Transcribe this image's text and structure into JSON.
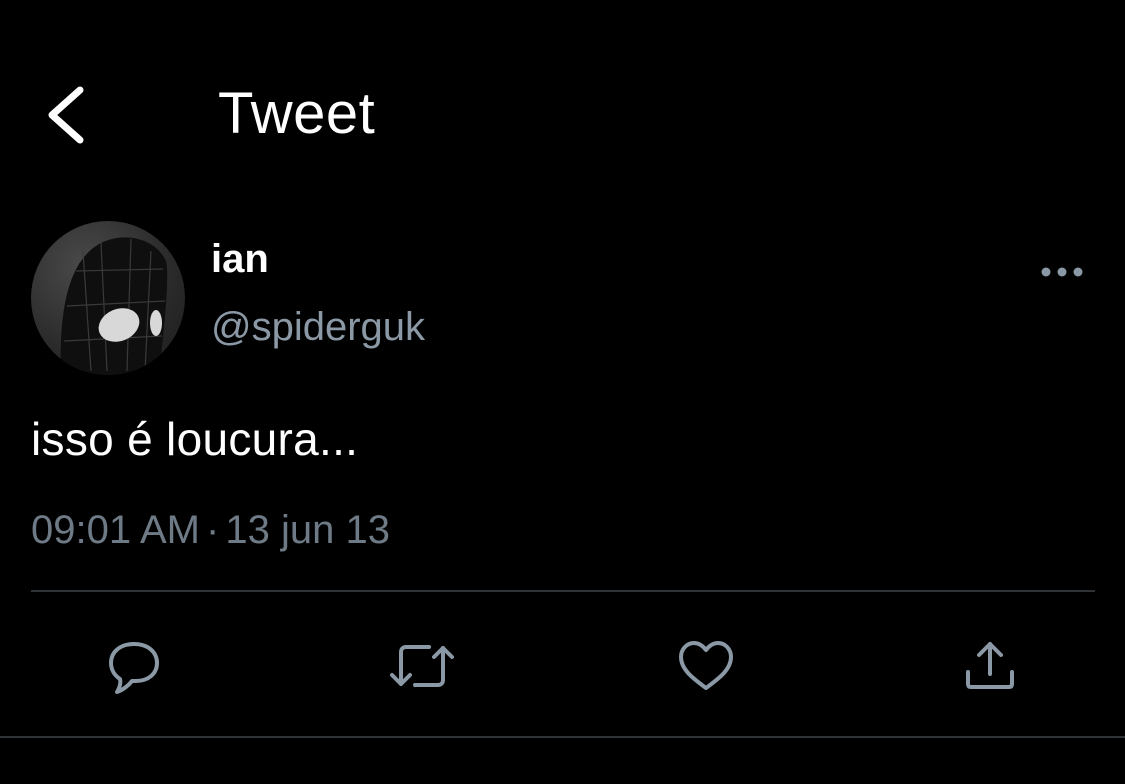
{
  "header": {
    "title": "Tweet",
    "back_icon": "chevron-left-icon"
  },
  "tweet": {
    "author": {
      "display_name": "ian",
      "handle": "@spiderguk",
      "avatar_icon": "spider-mask-avatar"
    },
    "text": "isso é loucura...",
    "time": "09:01 AM",
    "separator": "·",
    "date": "13 jun 13",
    "more_icon": "more-horizontal-icon"
  },
  "actions": [
    {
      "name": "reply",
      "icon": "comment-icon"
    },
    {
      "name": "retweet",
      "icon": "retweet-icon"
    },
    {
      "name": "like",
      "icon": "heart-icon"
    },
    {
      "name": "share",
      "icon": "share-icon"
    }
  ],
  "colors": {
    "background": "#000000",
    "text_primary": "#ffffff",
    "text_secondary": "#8b98a5",
    "divider": "#2f3336",
    "icon": "#8b98a5"
  }
}
